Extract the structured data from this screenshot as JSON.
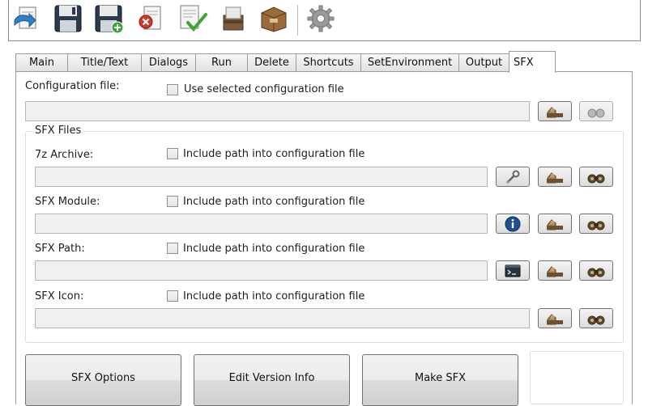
{
  "toolbar": {
    "buttons": [
      {
        "name": "open-icon"
      },
      {
        "name": "save-icon"
      },
      {
        "name": "save-as-icon"
      },
      {
        "name": "close-file-icon"
      },
      {
        "name": "check-icon"
      },
      {
        "name": "archive-icon"
      },
      {
        "name": "box-icon"
      },
      {
        "name": "gear-icon"
      }
    ]
  },
  "tabs": [
    "Main",
    "Title/Text",
    "Dialogs",
    "Run",
    "Delete",
    "Shortcuts",
    "SetEnvironment",
    "Output",
    "SFX"
  ],
  "config": {
    "label": "Configuration file:",
    "checkbox_label": "Use selected configuration file",
    "value": ""
  },
  "sfx_files": {
    "title": "SFX Files",
    "include_label": "Include path into configuration file",
    "rows": [
      {
        "label": "7z Archive:",
        "value": ""
      },
      {
        "label": "SFX Module:",
        "value": ""
      },
      {
        "label": "SFX Path:",
        "value": ""
      },
      {
        "label": "SFX Icon:",
        "value": ""
      }
    ]
  },
  "buttons": {
    "sfx_options": "SFX Options",
    "edit_version": "Edit Version Info",
    "make_sfx": "Make SFX"
  },
  "colors": {
    "accent": "#1e4f91",
    "panel_border": "#9c9c9c",
    "group_border": "#d5dfe5"
  }
}
